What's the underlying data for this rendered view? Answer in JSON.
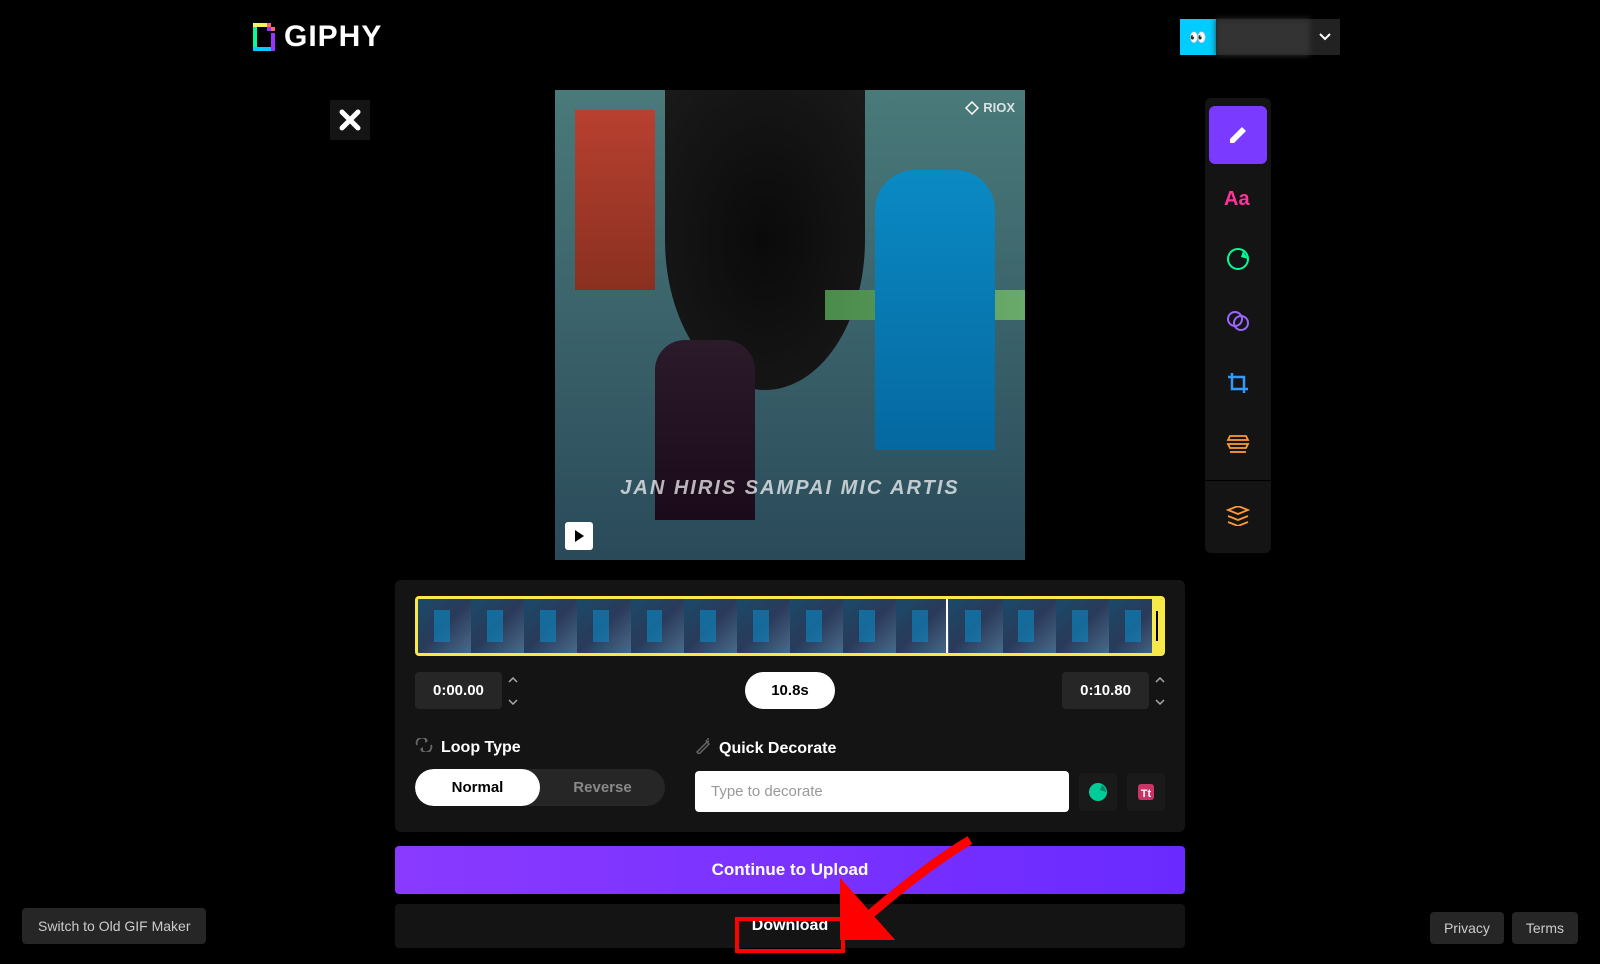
{
  "header": {
    "logo_text": "GIPHY",
    "user_avatar_emoji": "👀"
  },
  "preview": {
    "watermark": "RIOX",
    "overlay_text": "JAN HIRIS SAMPAI MIC ARTIS"
  },
  "timeline": {
    "start_time": "0:00.00",
    "duration": "10.8s",
    "end_time": "0:10.80"
  },
  "options": {
    "loop_label": "Loop Type",
    "loop_normal": "Normal",
    "loop_reverse": "Reverse",
    "decorate_label": "Quick Decorate",
    "decorate_placeholder": "Type to decorate"
  },
  "buttons": {
    "continue": "Continue to Upload",
    "download": "Download",
    "switch": "Switch to Old GIF Maker"
  },
  "footer": {
    "privacy": "Privacy",
    "terms": "Terms"
  }
}
